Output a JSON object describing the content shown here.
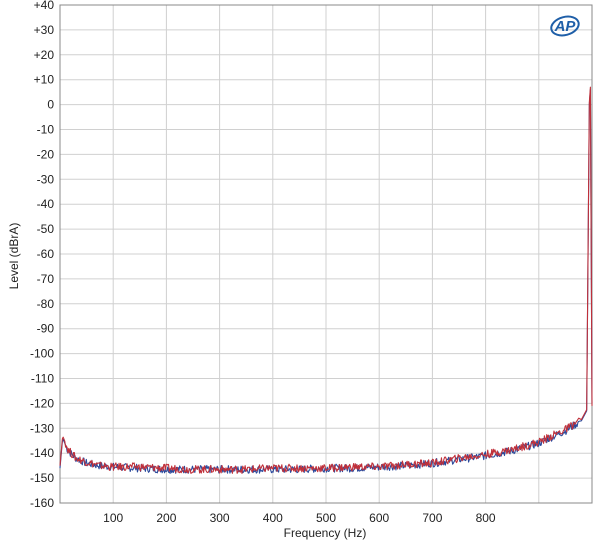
{
  "brand": {
    "logo_text": "AP",
    "logo_color": "#1f5fa8"
  },
  "chart_data": {
    "type": "line",
    "xlabel": "Frequency (Hz)",
    "ylabel": "Level (dBrA)",
    "xlim": [
      0,
      1000
    ],
    "ylim": [
      -160,
      40
    ],
    "grid": true,
    "x_ticks": [
      100,
      200,
      300,
      400,
      500,
      600,
      700,
      800
    ],
    "x_tick_labels": [
      "100",
      "200",
      "300",
      "400",
      "500",
      "600",
      "700",
      "800"
    ],
    "y_ticks": [
      40,
      30,
      20,
      10,
      0,
      -10,
      -20,
      -30,
      -40,
      -50,
      -60,
      -70,
      -80,
      -90,
      -100,
      -110,
      -120,
      -130,
      -140,
      -150,
      -160
    ],
    "y_tick_labels": [
      "+40",
      "+30",
      "+20",
      "+10",
      "0",
      "-10",
      "-20",
      "-30",
      "-40",
      "-50",
      "-60",
      "-70",
      "-80",
      "-90",
      "-100",
      "-110",
      "-120",
      "-130",
      "-140",
      "-150",
      "-160"
    ],
    "series": [
      {
        "color": "#2b4a9c",
        "x": [
          0,
          5,
          15,
          30,
          50,
          75,
          100,
          150,
          200,
          250,
          300,
          350,
          400,
          450,
          500,
          550,
          600,
          650,
          700,
          750,
          800,
          850,
          900,
          950,
          980,
          990,
          995,
          997,
          1000
        ],
        "values": [
          -146,
          -134,
          -139,
          -142,
          -144,
          -145,
          -145.5,
          -146,
          -146.5,
          -146.5,
          -146.5,
          -146.5,
          -146.5,
          -146.5,
          -146,
          -146,
          -145.5,
          -145,
          -144,
          -142.5,
          -141,
          -139,
          -136,
          -131,
          -127,
          -123,
          0,
          6,
          -120
        ]
      },
      {
        "color": "#c0303a",
        "x": [
          0,
          5,
          15,
          30,
          50,
          75,
          100,
          150,
          200,
          250,
          300,
          350,
          400,
          450,
          500,
          550,
          600,
          650,
          700,
          750,
          800,
          850,
          900,
          950,
          980,
          990,
          995,
          997,
          1000
        ],
        "values": [
          -145,
          -133,
          -138.5,
          -142,
          -143.5,
          -145,
          -145.5,
          -145.5,
          -146,
          -146.5,
          -146.5,
          -146.5,
          -146,
          -146,
          -146,
          -145.5,
          -145.5,
          -144.5,
          -144,
          -142,
          -140.5,
          -138.5,
          -135.5,
          -130.5,
          -126.5,
          -122.5,
          1,
          7,
          -121
        ]
      }
    ]
  }
}
